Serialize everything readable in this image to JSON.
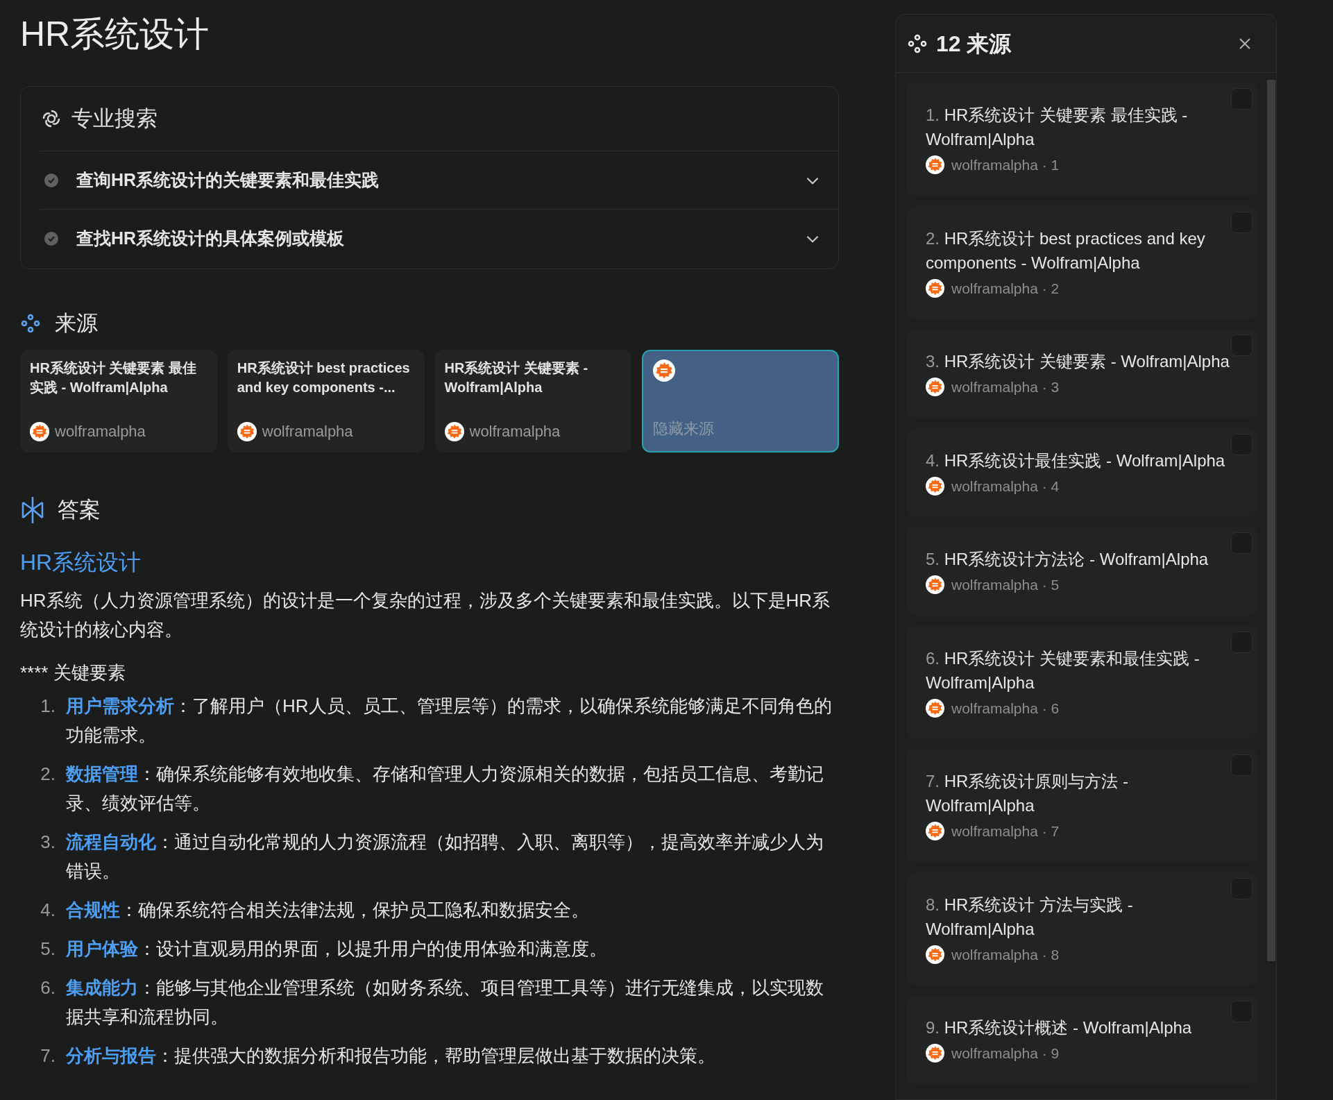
{
  "page_title": "HR系统设计",
  "pro_search": {
    "title": "专业搜索",
    "steps": [
      {
        "text": "查询HR系统设计的关键要素和最佳实践",
        "done": true,
        "expanded": false
      },
      {
        "text": "查找HR系统设计的具体案例或模板",
        "done": true,
        "expanded": false
      }
    ]
  },
  "sources": {
    "title": "来源",
    "cards": [
      {
        "kind": "source",
        "title": "HR系统设计 关键要素 最佳实践 - Wolfram|Alpha",
        "site": "wolframalpha"
      },
      {
        "kind": "source",
        "title": "HR系统设计 best practices and key components -...",
        "site": "wolframalpha"
      },
      {
        "kind": "source",
        "title": "HR系统设计 关键要素 - Wolfram|Alpha",
        "site": "wolframalpha"
      },
      {
        "kind": "toggle",
        "label": "隐藏来源",
        "selected": true
      }
    ]
  },
  "answer": {
    "title": "答案",
    "heading": "HR系统设计",
    "intro": "HR系统（人力资源管理系统）的设计是一个复杂的过程，涉及多个关键要素和最佳实践。以下是HR系统设计的核心内容。",
    "section": "**** 关键要素",
    "items": [
      {
        "number": "1.",
        "term": "用户需求分析",
        "text": "：了解用户（HR人员、员工、管理层等）的需求，以确保系统能够满足不同角色的功能需求。"
      },
      {
        "number": "2.",
        "term": "数据管理",
        "text": "：确保系统能够有效地收集、存储和管理人力资源相关的数据，包括员工信息、考勤记录、绩效评估等。"
      },
      {
        "number": "3.",
        "term": "流程自动化",
        "text": "：通过自动化常规的人力资源流程（如招聘、入职、离职等），提高效率并减少人为错误。"
      },
      {
        "number": "4.",
        "term": "合规性",
        "text": "：确保系统符合相关法律法规，保护员工隐私和数据安全。"
      },
      {
        "number": "5.",
        "term": "用户体验",
        "text": "：设计直观易用的界面，以提升用户的使用体验和满意度。"
      },
      {
        "number": "6.",
        "term": "集成能力",
        "text": "：能够与其他企业管理系统（如财务系统、项目管理工具等）进行无缝集成，以实现数据共享和流程协同。"
      },
      {
        "number": "7.",
        "term": "分析与报告",
        "text": "：提供强大的数据分析和报告功能，帮助管理层做出基于数据的决策。"
      }
    ]
  },
  "sources_panel": {
    "title": "12 来源",
    "items": [
      {
        "number": "1.",
        "title": "HR系统设计 关键要素 最佳实践 - Wolfram|Alpha",
        "meta": "wolframalpha · 1",
        "checked": false
      },
      {
        "number": "2.",
        "title": "HR系统设计 best practices and key components - Wolfram|Alpha",
        "meta": "wolframalpha · 2",
        "checked": false
      },
      {
        "number": "3.",
        "title": "HR系统设计 关键要素 - Wolfram|Alpha",
        "meta": "wolframalpha · 3",
        "checked": false
      },
      {
        "number": "4.",
        "title": "HR系统设计最佳实践 - Wolfram|Alpha",
        "meta": "wolframalpha · 4",
        "checked": false
      },
      {
        "number": "5.",
        "title": "HR系统设计方法论 - Wolfram|Alpha",
        "meta": "wolframalpha · 5",
        "checked": false
      },
      {
        "number": "6.",
        "title": "HR系统设计 关键要素和最佳实践 - Wolfram|Alpha",
        "meta": "wolframalpha · 6",
        "checked": false
      },
      {
        "number": "7.",
        "title": "HR系统设计原则与方法 - Wolfram|Alpha",
        "meta": "wolframalpha · 7",
        "checked": false
      },
      {
        "number": "8.",
        "title": "HR系统设计 方法与实践 - Wolfram|Alpha",
        "meta": "wolframalpha · 8",
        "checked": false
      },
      {
        "number": "9.",
        "title": "HR系统设计概述 - Wolfram|Alpha",
        "meta": "wolframalpha · 9",
        "checked": false
      }
    ]
  }
}
